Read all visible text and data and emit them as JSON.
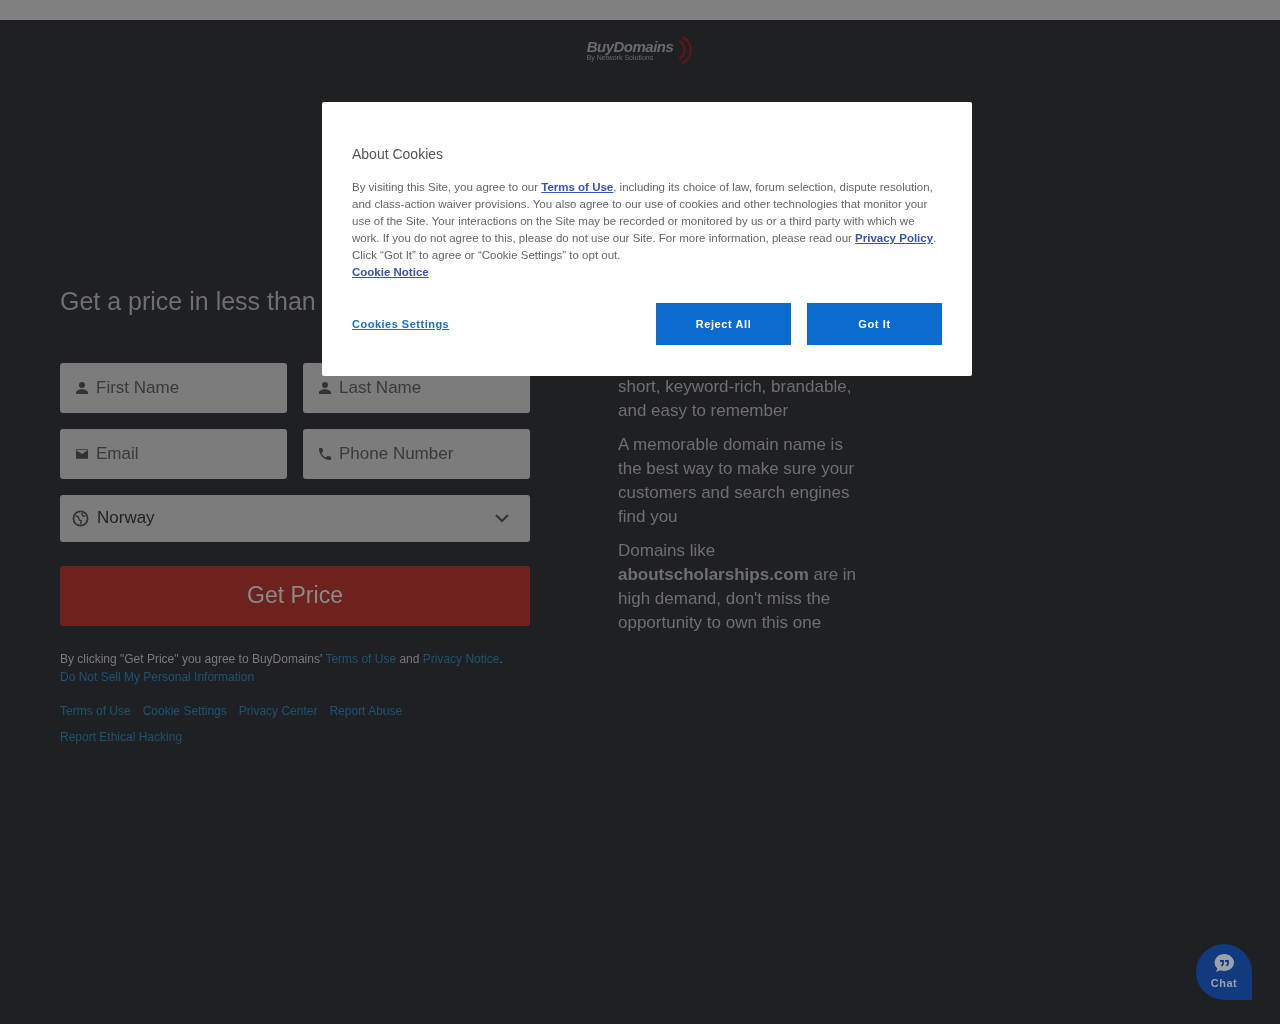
{
  "logo": {
    "name": "BuyDomains",
    "tagline": "By Network Solutions"
  },
  "form": {
    "heading": "Get a price in less than",
    "fields": [
      {
        "kind": "person",
        "placeholder": "First Name"
      },
      {
        "kind": "person",
        "placeholder": "Last Name"
      },
      {
        "kind": "email",
        "placeholder": "Email"
      },
      {
        "kind": "phone",
        "placeholder": "Phone Number"
      }
    ],
    "country": {
      "value": "Norway"
    },
    "submit": "Get Price",
    "consent": "By clicking \"Get Price\" you agree to BuyDomains' ",
    "consent_links": [
      "Terms of Use",
      "Privacy Notice"
    ],
    "consent_and": "and",
    "consent_end": ".",
    "do_not_sell": "Do Not Sell My Personal Information",
    "footer_links": [
      "Terms of Use",
      "Cookie Settings",
      "Privacy Center",
      "Report Abuse",
      "Report Ethical Hacking"
    ]
  },
  "info": {
    "paragraphs": [
      "short, keyword-rich, brandable, and easy to remember",
      "A memorable domain name is the best way to make sure your customers and search engines find you"
    ],
    "domain_intro": "Domains like",
    "domain": "aboutscholarships.com",
    "domain_outro": "are in high demand, don't miss the opportunity to own this one"
  },
  "cookie_dialog": {
    "title": "About Cookies",
    "body": [
      {
        "kind": "text",
        "text": "By visiting this Site, you agree to our "
      },
      {
        "kind": "link",
        "text": "Terms of Use"
      },
      {
        "kind": "text",
        "text": ", including its choice of law, forum selection, dispute resolution, and class-action waiver provisions. You also agree to our use of cookies and other technologies that monitor your use of the Site. Your interactions on the Site may be recorded or monitored by us or a third party with which we work. If you do not agree to this, please do not use our Site. For more information, please read our "
      },
      {
        "kind": "link",
        "text": "Privacy Policy"
      },
      {
        "kind": "text",
        "text": ". Click “Got It” to agree or “Cookie Settings” to opt out."
      }
    ],
    "notice_link": "Cookie Notice",
    "settings_link": "Cookies Settings",
    "buttons": [
      "Reject All",
      "Got It"
    ]
  },
  "chat": {
    "label": "Chat"
  }
}
